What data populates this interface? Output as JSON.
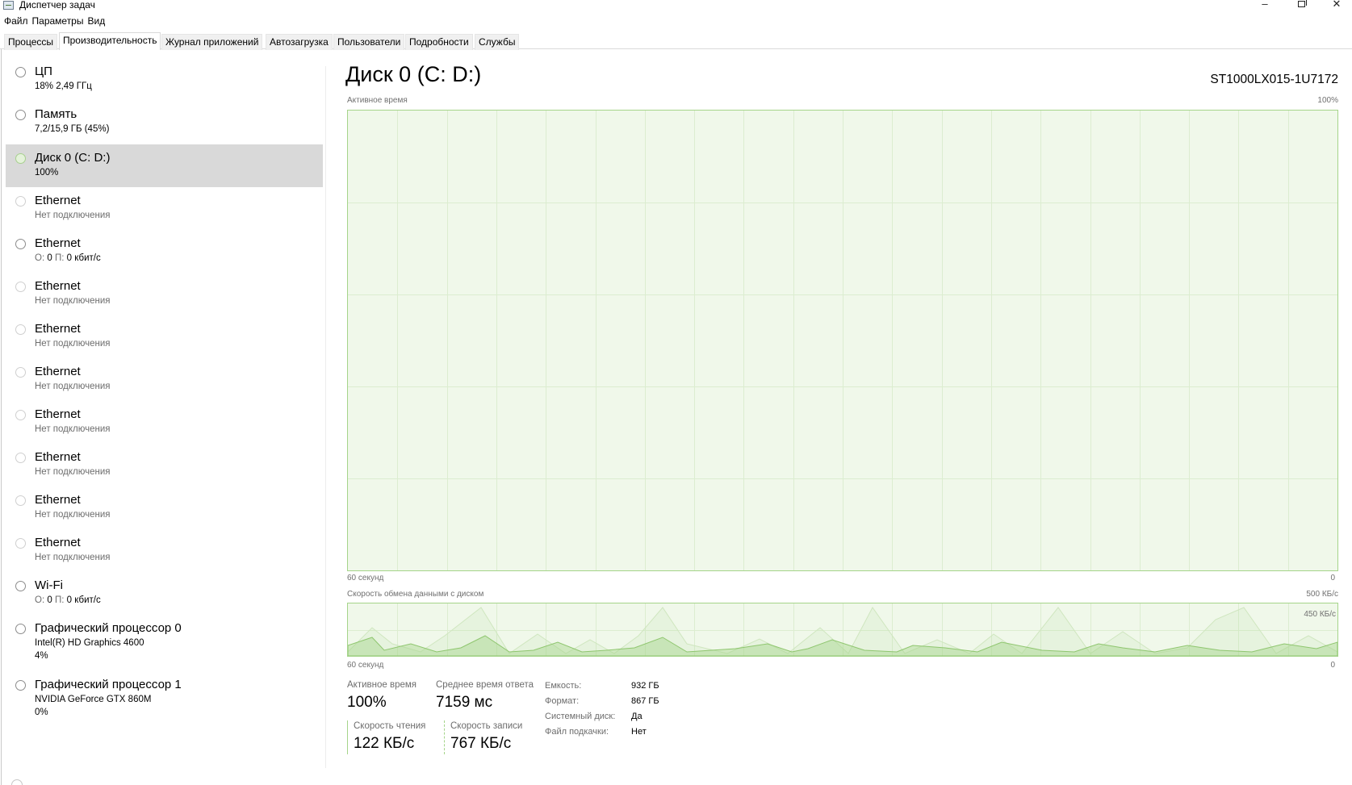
{
  "window": {
    "title": "Диспетчер задач",
    "minimize_glyph": "–",
    "close_glyph": "✕"
  },
  "menu": {
    "items": [
      "Файл",
      "Параметры",
      "Вид"
    ]
  },
  "tabs": [
    "Процессы",
    "Производительность",
    "Журнал приложений",
    "Автозагрузка",
    "Пользователи",
    "Подробности",
    "Службы"
  ],
  "sidebar": {
    "items": [
      {
        "name": "ЦП",
        "sub": "18%  2,49 ГГц"
      },
      {
        "name": "Память",
        "sub": "7,2/15,9 ГБ (45%)"
      },
      {
        "name": "Диск 0 (C: D:)",
        "sub": "100%"
      },
      {
        "name": "Ethernet",
        "sub": "Нет подключения"
      },
      {
        "name": "Ethernet",
        "sub_o": "О:",
        "sub_o_val": "0",
        "sub_p": "П:",
        "sub_p_val": "0 кбит/с"
      },
      {
        "name": "Ethernet",
        "sub": "Нет подключения"
      },
      {
        "name": "Ethernet",
        "sub": "Нет подключения"
      },
      {
        "name": "Ethernet",
        "sub": "Нет подключения"
      },
      {
        "name": "Ethernet",
        "sub": "Нет подключения"
      },
      {
        "name": "Ethernet",
        "sub": "Нет подключения"
      },
      {
        "name": "Ethernet",
        "sub": "Нет подключения"
      },
      {
        "name": "Ethernet",
        "sub": "Нет подключения"
      },
      {
        "name": "Wi-Fi",
        "sub_o": "О:",
        "sub_o_val": "0",
        "sub_p": "П:",
        "sub_p_val": "0 кбит/с"
      },
      {
        "name": "Графический процессор 0",
        "sub": "Intel(R) HD Graphics 4600",
        "sub2": "4%"
      },
      {
        "name": "Графический процессор 1",
        "sub": "NVIDIA GeForce GTX 860M",
        "sub2": "0%"
      }
    ]
  },
  "main": {
    "title": "Диск 0 (C: D:)",
    "model": "ST1000LX015-1U7172",
    "active_graph": {
      "label": "Активное время",
      "max_label": "100%",
      "time_label": "60 секунд",
      "zero_label": "0",
      "value_percent": 100
    },
    "transfer_graph": {
      "label": "Скорость обмена данными с диском",
      "max_label": "500 КБ/с",
      "inner_label": "450 КБ/с",
      "time_label": "60 секунд",
      "zero_label": "0"
    },
    "stats": {
      "active_time_label": "Активное время",
      "active_time_value": "100%",
      "response_label": "Среднее время ответа",
      "response_value": "7159 мс",
      "read_label": "Скорость чтения",
      "read_value": "122 КБ/с",
      "write_label": "Скорость записи",
      "write_value": "767 КБ/с"
    },
    "properties": [
      {
        "label": "Емкость:",
        "value": "932 ГБ"
      },
      {
        "label": "Формат:",
        "value": "867 ГБ"
      },
      {
        "label": "Системный диск:",
        "value": "Да"
      },
      {
        "label": "Файл подкачки:",
        "value": "Нет"
      }
    ]
  },
  "colors": {
    "disk_accent": "#a5d48a",
    "graph_fill": "#f0f8ea",
    "selected_bg": "#d9d9d9"
  }
}
